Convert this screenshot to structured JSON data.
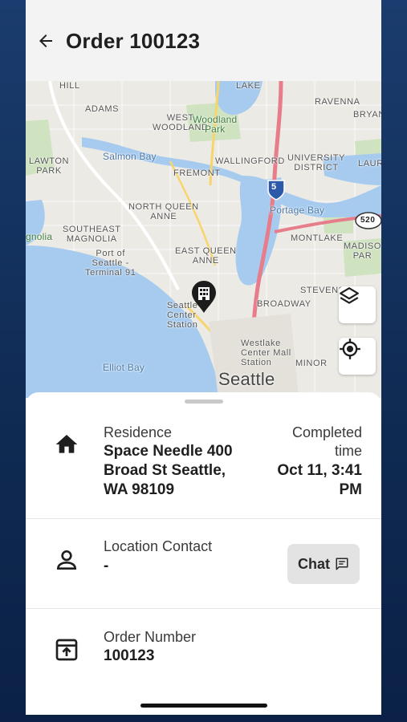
{
  "header": {
    "title": "Order 100123"
  },
  "map": {
    "labels": {
      "hill": "HILL",
      "lake": "LAKE",
      "adams": "ADAMS",
      "west_woodland": "WEST\nWOODLAND",
      "woodland_park": "Woodland\nPark",
      "ravenna": "RAVENNA",
      "bryant": "BRYAN",
      "salmon_bay": "Salmon Bay",
      "lawton_park": "LAWTON\nPARK",
      "fremont": "FREMONT",
      "wallingford": "WALLINGFORD",
      "university_district": "UNIVERSITY\nDISTRICT",
      "laur": "LAUR",
      "north_queen_anne": "NORTH QUEEN\nANNE",
      "portage_bay": "Portage Bay",
      "magnolia": "gnolia",
      "southeast_magnolia": "SOUTHEAST\nMAGNOLIA",
      "port_of_seattle": "Port of\nSeattle -\nTerminal 91",
      "montlake": "MONTLAKE",
      "madison": "MADISO\nPAR",
      "east_queen_anne": "EAST QUEEN\nANNE",
      "stevens": "STEVENS",
      "broadway": "BROADWAY",
      "seattle_center": "Seattle\nCenter\nStation",
      "elliot_bay": "Elliot Bay",
      "westlake": "Westlake\nCenter Mall\nStation",
      "minor": "MINOR",
      "seattle": "Seattle",
      "i5": "5",
      "sr520": "520"
    }
  },
  "sheet": {
    "residence": {
      "label": "Residence",
      "address_line1": "Space Needle 400",
      "address_line2": "Broad St Seattle,",
      "address_line3": "WA 98109",
      "status_label_line1": "Completed",
      "status_label_line2": "time",
      "status_value_line1": "Oct 11, 3:41",
      "status_value_line2": "PM"
    },
    "contact": {
      "label": "Location Contact",
      "value": "-",
      "chat_label": "Chat"
    },
    "order": {
      "label": "Order Number",
      "value": "100123"
    }
  }
}
